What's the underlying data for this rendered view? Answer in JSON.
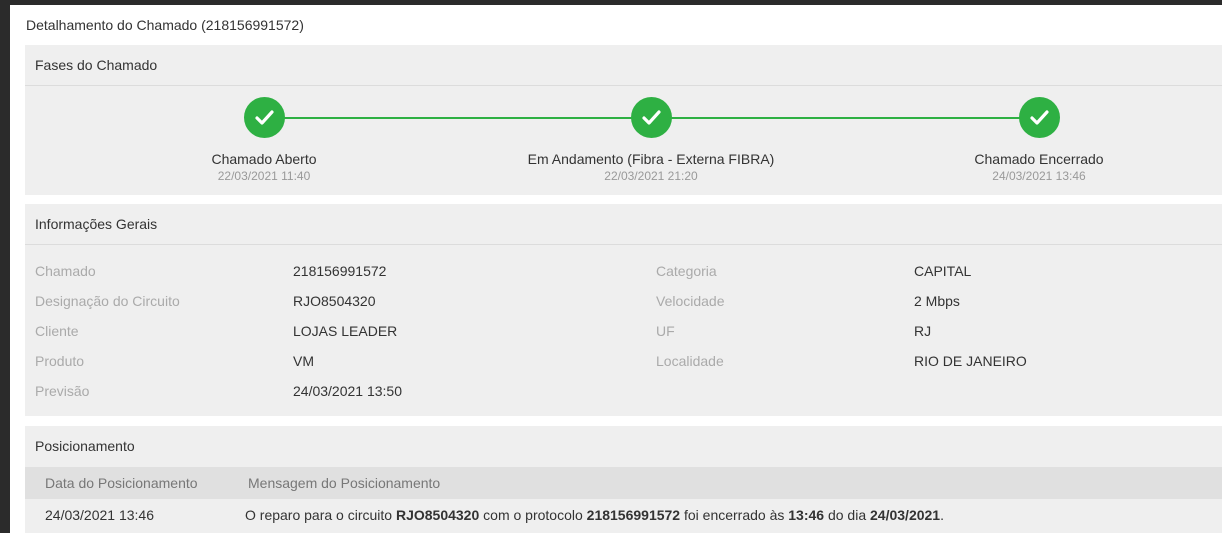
{
  "page": {
    "title": "Detalhamento do Chamado (218156991572)"
  },
  "phases": {
    "header": "Fases do Chamado",
    "items": [
      {
        "label": "Chamado Aberto",
        "date": "22/03/2021 11:40"
      },
      {
        "label": "Em Andamento (Fibra - Externa FIBRA)",
        "date": "22/03/2021 21:20"
      },
      {
        "label": "Chamado Encerrado",
        "date": "24/03/2021 13:46"
      }
    ],
    "accent_color": "#2eb043",
    "icon": "check-icon"
  },
  "info": {
    "header": "Informações Gerais",
    "left": [
      {
        "label": "Chamado",
        "value": "218156991572"
      },
      {
        "label": "Designação do Circuito",
        "value": "RJO8504320"
      },
      {
        "label": "Cliente",
        "value": "LOJAS LEADER"
      },
      {
        "label": "Produto",
        "value": "VM"
      },
      {
        "label": "Previsão",
        "value": "24/03/2021 13:50"
      }
    ],
    "right": [
      {
        "label": "Categoria",
        "value": "CAPITAL"
      },
      {
        "label": "Velocidade",
        "value": "2 Mbps"
      },
      {
        "label": "UF",
        "value": "RJ"
      },
      {
        "label": "Localidade",
        "value": "RIO DE JANEIRO"
      }
    ]
  },
  "positioning": {
    "header": "Posicionamento",
    "columns": [
      "Data do Posicionamento",
      "Mensagem do Posicionamento"
    ],
    "rows": [
      {
        "date": "24/03/2021 13:46",
        "message": {
          "t1": "O reparo para o circuito ",
          "b1": "RJO8504320",
          "t2": " com o protocolo ",
          "b2": "218156991572",
          "t3": " foi encerrado às ",
          "b3": "13:46",
          "t4": " do dia ",
          "b4": "24/03/2021",
          "t5": "."
        }
      }
    ]
  }
}
